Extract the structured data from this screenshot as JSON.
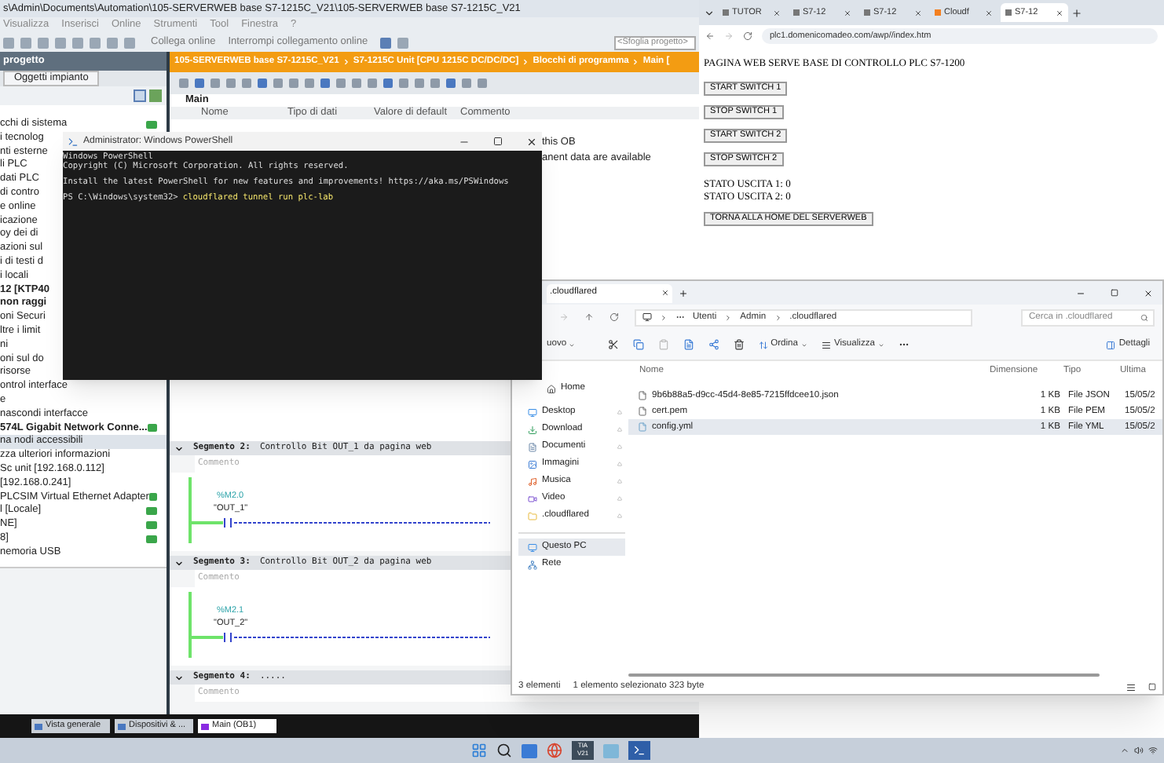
{
  "tia": {
    "title": "s\\Admin\\Documents\\Automation\\105-SERVERWEB base S7-1215C_V21\\105-SERVERWEB base S7-1215C_V21",
    "menu": [
      "Visualizza",
      "Inserisci",
      "Online",
      "Strumenti",
      "Tool",
      "Finestra",
      "?"
    ],
    "toolbar": {
      "go_online": "Collega online",
      "go_offline": "Interrompi collegamento online",
      "search": {
        "placeholder": "<Sfoglia progetto>"
      }
    },
    "project_panel": {
      "title": "progetto",
      "tab": "Oggetti impianto",
      "tree": [
        {
          "label": "cchi di sistema",
          "selected": false,
          "status": true,
          "bold": false
        },
        {
          "label": "i tecnolog",
          "selected": false,
          "status": false,
          "bold": false
        },
        {
          "label": "nti esterne",
          "selected": false,
          "status": false,
          "bold": false
        },
        {
          "label": "li PLC",
          "selected": false,
          "status": false,
          "bold": false
        },
        {
          "label": "dati PLC",
          "selected": false,
          "status": false,
          "bold": false
        },
        {
          "label": "di contro",
          "selected": false,
          "status": false,
          "bold": false
        },
        {
          "label": "e online",
          "selected": false,
          "status": false,
          "bold": false
        },
        {
          "label": "icazione",
          "selected": false,
          "status": false,
          "bold": false
        },
        {
          "label": "oy dei di",
          "selected": false,
          "status": false,
          "bold": false
        },
        {
          "label": "azioni sul",
          "selected": false,
          "status": false,
          "bold": false
        },
        {
          "label": "i di testi d",
          "selected": false,
          "status": false,
          "bold": false
        },
        {
          "label": "i locali",
          "selected": false,
          "status": false,
          "bold": false
        },
        {
          "label": "12 [KTP40",
          "selected": false,
          "status": false,
          "bold": true
        },
        {
          "label": "non raggi",
          "selected": false,
          "status": false,
          "bold": true
        },
        {
          "label": "oni Securi",
          "selected": false,
          "status": false,
          "bold": false
        },
        {
          "label": "ltre i limit",
          "selected": false,
          "status": false,
          "bold": false
        },
        {
          "label": "ni",
          "selected": false,
          "status": false,
          "bold": false
        },
        {
          "label": "oni sul do",
          "selected": false,
          "status": false,
          "bold": false
        },
        {
          "label": "risorse",
          "selected": false,
          "status": false,
          "bold": false
        },
        {
          "label": "ontrol interface",
          "selected": false,
          "status": false,
          "bold": false
        },
        {
          "label": "e",
          "selected": false,
          "status": false,
          "bold": false
        },
        {
          "label": "nascondi interfacce",
          "selected": false,
          "status": false,
          "bold": false
        },
        {
          "label": "574L Gigabit Network Conne...",
          "selected": false,
          "status": true,
          "bold": true
        },
        {
          "label": "na nodi accessibili",
          "selected": true,
          "status": false,
          "bold": false
        },
        {
          "label": "zza ulteriori informazioni",
          "selected": false,
          "status": false,
          "bold": false
        },
        {
          "label": "Sc unit [192.168.0.112]",
          "selected": false,
          "status": false,
          "bold": false
        },
        {
          "label": "[192.168.0.241]",
          "selected": false,
          "status": false,
          "bold": false
        },
        {
          "label": "PLCSIM Virtual Ethernet Adapter",
          "selected": false,
          "status": true,
          "bold": false
        },
        {
          "label": "l [Locale]",
          "selected": false,
          "status": true,
          "bold": false
        },
        {
          "label": "NE]",
          "selected": false,
          "status": true,
          "bold": false
        },
        {
          "label": "8]",
          "selected": false,
          "status": true,
          "bold": false
        },
        {
          "label": "nemoria USB",
          "selected": false,
          "status": false,
          "bold": false
        }
      ]
    },
    "breadcrumb": [
      "105-SERVERWEB base S7-1215C_V21",
      "S7-1215C Unit [CPU 1215C DC/DC/DC]",
      "Blocchi di programma",
      "Main ["
    ],
    "block": {
      "title": "Main",
      "columns": [
        "Nome",
        "Tipo di dati",
        "Valore di default",
        "Commento"
      ],
      "rows": [
        {
          "comment": "this OB"
        },
        {
          "comment": "anent data are available"
        }
      ],
      "segments": [
        {
          "title": "Segmento 2:",
          "description": "Controllo Bit OUT_1 da pagina web",
          "comment": "Commento",
          "contact": {
            "address": "%M2.0",
            "tag": "\"OUT_1\""
          }
        },
        {
          "title": "Segmento 3:",
          "description": "Controllo Bit OUT_2 da pagina web",
          "comment": "Commento",
          "contact": {
            "address": "%M2.1",
            "tag": "\"OUT_2\""
          }
        },
        {
          "title": "Segmento 4:",
          "description": ".....",
          "comment": "Commento"
        }
      ]
    },
    "editor_tabs": [
      {
        "label": "Vista generale",
        "selected": false
      },
      {
        "label": "Dispositivi & ...",
        "selected": false
      },
      {
        "label": "Main (OB1)",
        "selected": true
      }
    ]
  },
  "powershell": {
    "title": "Administrator: Windows PowerShell",
    "lines": [
      "Windows PowerShell",
      "Copyright (C) Microsoft Corporation. All rights reserved.",
      "Install the latest PowerShell for new features and improvements! https://aka.ms/PSWindows"
    ],
    "prompt": "PS C:\\Windows\\system32>",
    "command": "cloudflared tunnel run plc-lab"
  },
  "browser": {
    "tabs": [
      {
        "label": "TUTOR",
        "selected": false
      },
      {
        "label": "S7-12",
        "selected": false
      },
      {
        "label": "S7-12",
        "selected": false
      },
      {
        "label": "Cloudf",
        "selected": false
      },
      {
        "label": "S7-12",
        "selected": true
      }
    ],
    "url": "plc1.domenicomadeo.com/awp//index.htm",
    "page": {
      "heading": "PAGINA WEB SERVE BASE DI CONTROLLO PLC S7-1200",
      "buttons": [
        "START SWITCH 1",
        "STOP SWITCH 1",
        "START SWITCH 2",
        "STOP SWITCH 2"
      ],
      "status": [
        "STATO USCITA 1: 0",
        "STATO USCITA 2: 0"
      ],
      "home_button": "TORNA ALLA HOME DEL SERVERWEB"
    }
  },
  "explorer": {
    "tab": ".cloudflared",
    "path": [
      "Utenti",
      "Admin",
      ".cloudflared"
    ],
    "search": {
      "placeholder": "Cerca in .cloudflared"
    },
    "toolbar": {
      "new": "uovo",
      "sort": "Ordina",
      "view": "Visualizza",
      "details": "Dettagli"
    },
    "nav": [
      {
        "label": "Home",
        "kind": "home"
      },
      {
        "label": "Desktop",
        "kind": "desktop"
      },
      {
        "label": "Download",
        "kind": "download"
      },
      {
        "label": "Documenti",
        "kind": "documents"
      },
      {
        "label": "Immagini",
        "kind": "images"
      },
      {
        "label": "Musica",
        "kind": "music"
      },
      {
        "label": "Video",
        "kind": "video"
      },
      {
        "label": ".cloudflared",
        "kind": "folder"
      },
      {
        "label": "Questo PC",
        "kind": "pc"
      },
      {
        "label": "Rete",
        "kind": "network"
      }
    ],
    "columns": [
      "Nome",
      "Dimensione",
      "Tipo",
      "Ultima"
    ],
    "files": [
      {
        "name": "9b6b88a5-d9cc-45d4-8e85-7215ffdcee10.json",
        "size": "1 KB",
        "type": "File JSON",
        "date": "15/05/2",
        "selected": false
      },
      {
        "name": "cert.pem",
        "size": "1 KB",
        "type": "File PEM",
        "date": "15/05/2",
        "selected": false
      },
      {
        "name": "config.yml",
        "size": "1 KB",
        "type": "File YML",
        "date": "15/05/2",
        "selected": true
      }
    ],
    "status": [
      "3 elementi",
      "1 elemento selezionato 323 byte"
    ]
  },
  "taskbar": {
    "tia_label": "TIA V21"
  }
}
